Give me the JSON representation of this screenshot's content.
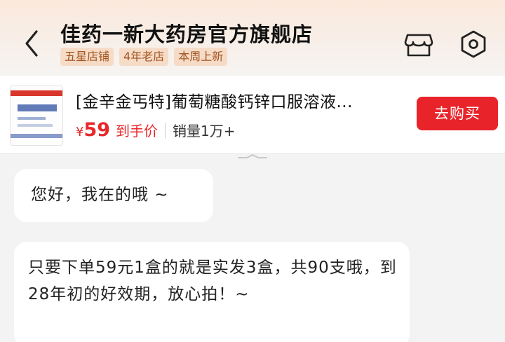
{
  "header": {
    "store_name": "佳药一新大药房官方旗舰店",
    "tags": [
      "五星店铺",
      "4年老店",
      "本周上新"
    ],
    "icons": [
      "back-icon",
      "store-icon",
      "settings-icon"
    ]
  },
  "product": {
    "name": "[金辛金丐特]葡萄糖酸钙锌口服溶液...",
    "currency": "¥",
    "price": "59",
    "price_note": "到手价",
    "sales": "销量1万+",
    "buy_label": "去购买"
  },
  "messages": [
    {
      "text": "您好，我在的哦 ~"
    },
    {
      "text": "只要下单59元1盒的就是实发3盒，共90支哦，到28年初的好效期，放心拍！~"
    }
  ],
  "colors": {
    "accent_red": "#e8242a",
    "tag_text": "#a0521f",
    "tag_bg": "#f6dcc7"
  }
}
